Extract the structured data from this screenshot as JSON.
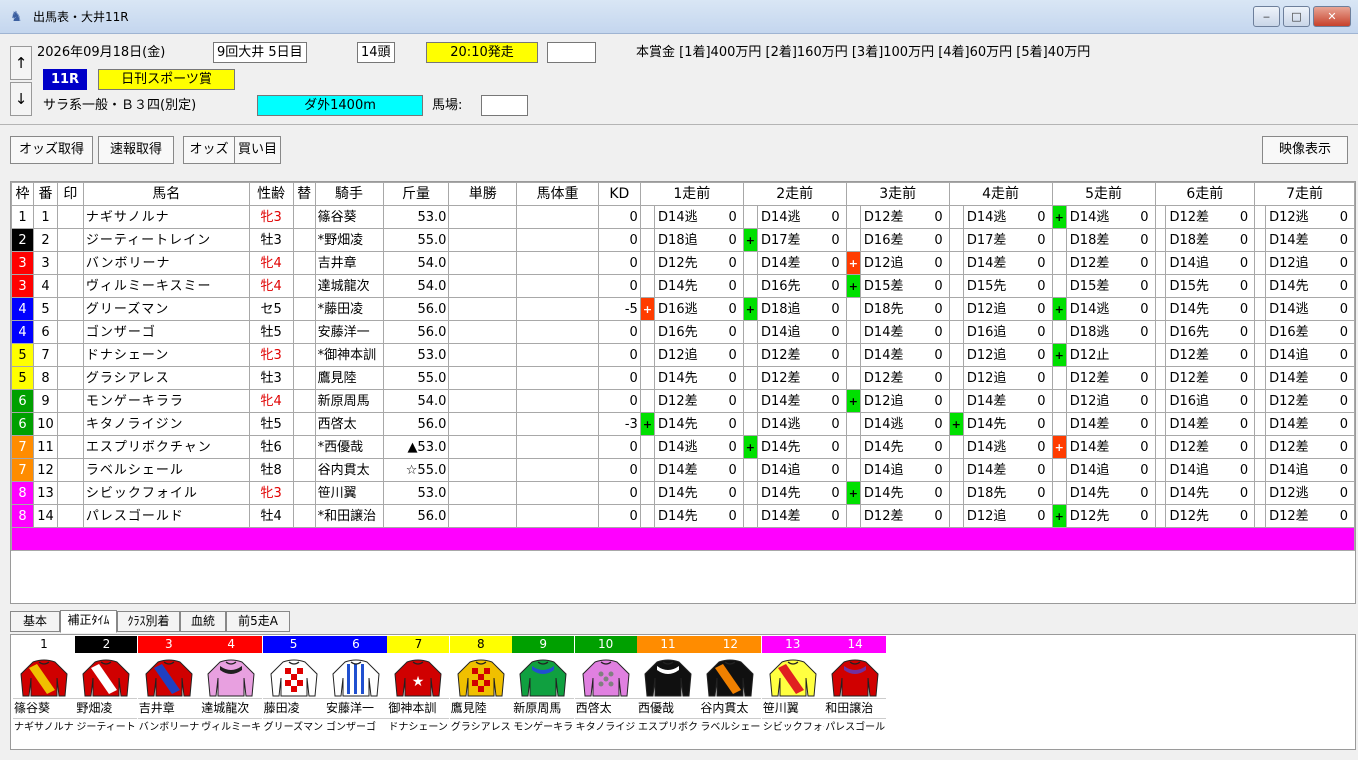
{
  "window": {
    "title": "出馬表・大井11R",
    "minimize": "‒",
    "maximize": "□",
    "close": "✕"
  },
  "header": {
    "up": "↑",
    "down": "↓",
    "date": "2026年09月18日(金)",
    "meeting": "9回大井 5日目",
    "runners": "14頭",
    "post_time": "20:10発走",
    "extra_box": "",
    "prize": "本賞金 [1着]400万円 [2着]160万円 [3着]100万円 [4着]60万円 [5着]40万円",
    "race_number": "11R",
    "race_name": "日刊スポーツ賞",
    "conditions": "サラ系一般・Ｂ３四(別定)",
    "course": "ダ外1400m",
    "going_label": "馬場:",
    "going_value": ""
  },
  "toolbar": {
    "odds_fetch": "オッズ取得",
    "flash_fetch": "速報取得",
    "odds": "オッズ",
    "bets": "買い目",
    "video": "映像表示"
  },
  "colors": {
    "frame": [
      "#ffffff",
      "#000000",
      "#ff0000",
      "#0000ff",
      "#ffff00",
      "#00a000",
      "#ff8c00",
      "#ff00ff"
    ]
  },
  "columns": {
    "frame": "枠",
    "number": "番",
    "mark": "印",
    "horse": "馬名",
    "sexage": "性齢",
    "change": "替",
    "jockey": "騎手",
    "weight": "斤量",
    "win": "単勝",
    "bodyweight": "馬体重",
    "kd": "KD",
    "prev": [
      "1走前",
      "2走前",
      "3走前",
      "4走前",
      "5走前",
      "6走前",
      "7走前"
    ]
  },
  "rows": [
    {
      "frame": "1",
      "fi": 0,
      "num": "1",
      "horse": "ナギサノルナ",
      "sexage": "牝3",
      "female": true,
      "jockey": "篠谷葵",
      "weight": "53.0",
      "kd": "0",
      "prev": [
        [
          "",
          "D14逃",
          "0"
        ],
        [
          "",
          "D14逃",
          "0"
        ],
        [
          "",
          "D12差",
          "0"
        ],
        [
          "",
          "D14逃",
          "0"
        ],
        [
          "g",
          "D14逃",
          "0"
        ],
        [
          "",
          "D12差",
          "0"
        ],
        [
          "",
          "D12逃",
          "0"
        ]
      ]
    },
    {
      "frame": "2",
      "fi": 1,
      "num": "2",
      "horse": "ジーティートレイン",
      "sexage": "牡3",
      "female": false,
      "jockey": "*野畑凌",
      "weight": "55.0",
      "kd": "0",
      "prev": [
        [
          "",
          "D18追",
          "0"
        ],
        [
          "g",
          "D17差",
          "0"
        ],
        [
          "",
          "D16差",
          "0"
        ],
        [
          "",
          "D17差",
          "0"
        ],
        [
          "",
          "D18差",
          "0"
        ],
        [
          "",
          "D18差",
          "0"
        ],
        [
          "",
          "D14差",
          "0"
        ]
      ]
    },
    {
      "frame": "3",
      "fi": 2,
      "num": "3",
      "horse": "バンボリーナ",
      "sexage": "牝4",
      "female": true,
      "jockey": "吉井章",
      "weight": "54.0",
      "kd": "0",
      "prev": [
        [
          "",
          "D12先",
          "0"
        ],
        [
          "",
          "D14差",
          "0"
        ],
        [
          "r",
          "D12追",
          "0"
        ],
        [
          "",
          "D14差",
          "0"
        ],
        [
          "",
          "D12差",
          "0"
        ],
        [
          "",
          "D14追",
          "0"
        ],
        [
          "",
          "D12追",
          "0"
        ]
      ]
    },
    {
      "frame": "3",
      "fi": 2,
      "num": "4",
      "horse": "ヴィルミーキスミー",
      "sexage": "牝4",
      "female": true,
      "jockey": "達城龍次",
      "weight": "54.0",
      "kd": "0",
      "prev": [
        [
          "",
          "D14先",
          "0"
        ],
        [
          "",
          "D16先",
          "0"
        ],
        [
          "g",
          "D15差",
          "0"
        ],
        [
          "",
          "D15先",
          "0"
        ],
        [
          "",
          "D15差",
          "0"
        ],
        [
          "",
          "D15先",
          "0"
        ],
        [
          "",
          "D14先",
          "0"
        ]
      ]
    },
    {
      "frame": "4",
      "fi": 3,
      "num": "5",
      "horse": "グリーズマン",
      "sexage": "セ5",
      "female": false,
      "jockey": "*藤田凌",
      "weight": "56.0",
      "kd": "-5",
      "prev": [
        [
          "r",
          "D16逃",
          "0"
        ],
        [
          "g",
          "D18追",
          "0"
        ],
        [
          "",
          "D18先",
          "0"
        ],
        [
          "",
          "D12追",
          "0"
        ],
        [
          "g",
          "D14逃",
          "0"
        ],
        [
          "",
          "D14先",
          "0"
        ],
        [
          "",
          "D14逃",
          "0"
        ]
      ]
    },
    {
      "frame": "4",
      "fi": 3,
      "num": "6",
      "horse": "ゴンザーゴ",
      "sexage": "牡5",
      "female": false,
      "jockey": "安藤洋一",
      "weight": "56.0",
      "kd": "0",
      "prev": [
        [
          "",
          "D16先",
          "0"
        ],
        [
          "",
          "D14追",
          "0"
        ],
        [
          "",
          "D14差",
          "0"
        ],
        [
          "",
          "D16追",
          "0"
        ],
        [
          "",
          "D18逃",
          "0"
        ],
        [
          "",
          "D16先",
          "0"
        ],
        [
          "",
          "D16差",
          "0"
        ]
      ]
    },
    {
      "frame": "5",
      "fi": 4,
      "num": "7",
      "horse": "ドナシェーン",
      "sexage": "牝3",
      "female": true,
      "jockey": "*御神本訓",
      "weight": "53.0",
      "kd": "0",
      "prev": [
        [
          "",
          "D12追",
          "0"
        ],
        [
          "",
          "D12差",
          "0"
        ],
        [
          "",
          "D14差",
          "0"
        ],
        [
          "",
          "D12追",
          "0"
        ],
        [
          "g",
          "D12止",
          ""
        ],
        [
          "",
          "D12差",
          "0"
        ],
        [
          "",
          "D14追",
          "0"
        ]
      ]
    },
    {
      "frame": "5",
      "fi": 4,
      "num": "8",
      "horse": "グラシアレス",
      "sexage": "牡3",
      "female": false,
      "jockey": "鷹見陸",
      "weight": "55.0",
      "kd": "0",
      "prev": [
        [
          "",
          "D14先",
          "0"
        ],
        [
          "",
          "D12差",
          "0"
        ],
        [
          "",
          "D12差",
          "0"
        ],
        [
          "",
          "D12追",
          "0"
        ],
        [
          "",
          "D12差",
          "0"
        ],
        [
          "",
          "D12差",
          "0"
        ],
        [
          "",
          "D14差",
          "0"
        ]
      ]
    },
    {
      "frame": "6",
      "fi": 5,
      "num": "9",
      "horse": "モンゲーキララ",
      "sexage": "牝4",
      "female": true,
      "jockey": "新原周馬",
      "weight": "54.0",
      "kd": "0",
      "prev": [
        [
          "",
          "D12差",
          "0"
        ],
        [
          "",
          "D14差",
          "0"
        ],
        [
          "g",
          "D12追",
          "0"
        ],
        [
          "",
          "D14差",
          "0"
        ],
        [
          "",
          "D12追",
          "0"
        ],
        [
          "",
          "D16追",
          "0"
        ],
        [
          "",
          "D12差",
          "0"
        ]
      ]
    },
    {
      "frame": "6",
      "fi": 5,
      "num": "10",
      "horse": "キタノライジン",
      "sexage": "牡5",
      "female": false,
      "jockey": "西啓太",
      "weight": "56.0",
      "kd": "-3",
      "prev": [
        [
          "g",
          "D14先",
          "0"
        ],
        [
          "",
          "D14逃",
          "0"
        ],
        [
          "",
          "D14逃",
          "0"
        ],
        [
          "g",
          "D14先",
          "0"
        ],
        [
          "",
          "D14差",
          "0"
        ],
        [
          "",
          "D14差",
          "0"
        ],
        [
          "",
          "D14差",
          "0"
        ]
      ]
    },
    {
      "frame": "7",
      "fi": 6,
      "num": "11",
      "horse": "エスプリボクチャン",
      "sexage": "牡6",
      "female": false,
      "jockey": "*西優哉",
      "weight": "▲53.0",
      "kd": "0",
      "prev": [
        [
          "",
          "D14逃",
          "0"
        ],
        [
          "g",
          "D14先",
          "0"
        ],
        [
          "",
          "D14先",
          "0"
        ],
        [
          "",
          "D14逃",
          "0"
        ],
        [
          "r",
          "D14差",
          "0"
        ],
        [
          "",
          "D12差",
          "0"
        ],
        [
          "",
          "D12差",
          "0"
        ]
      ]
    },
    {
      "frame": "7",
      "fi": 6,
      "num": "12",
      "horse": "ラベルシェール",
      "sexage": "牡8",
      "female": false,
      "jockey": "谷内貫太",
      "weight": "☆55.0",
      "kd": "0",
      "prev": [
        [
          "",
          "D14差",
          "0"
        ],
        [
          "",
          "D14追",
          "0"
        ],
        [
          "",
          "D14追",
          "0"
        ],
        [
          "",
          "D14差",
          "0"
        ],
        [
          "",
          "D14追",
          "0"
        ],
        [
          "",
          "D14追",
          "0"
        ],
        [
          "",
          "D14追",
          "0"
        ]
      ]
    },
    {
      "frame": "8",
      "fi": 7,
      "num": "13",
      "horse": "シビックフォイル",
      "sexage": "牝3",
      "female": true,
      "jockey": "笹川翼",
      "weight": "53.0",
      "kd": "0",
      "prev": [
        [
          "",
          "D14先",
          "0"
        ],
        [
          "",
          "D14先",
          "0"
        ],
        [
          "g",
          "D14先",
          "0"
        ],
        [
          "",
          "D18先",
          "0"
        ],
        [
          "",
          "D14先",
          "0"
        ],
        [
          "",
          "D14先",
          "0"
        ],
        [
          "",
          "D12逃",
          "0"
        ]
      ]
    },
    {
      "frame": "8",
      "fi": 7,
      "num": "14",
      "horse": "パレスゴールド",
      "sexage": "牡4",
      "female": false,
      "jockey": "*和田譲治",
      "weight": "56.0",
      "kd": "0",
      "prev": [
        [
          "",
          "D14先",
          "0"
        ],
        [
          "",
          "D14差",
          "0"
        ],
        [
          "",
          "D12差",
          "0"
        ],
        [
          "",
          "D12追",
          "0"
        ],
        [
          "g",
          "D12先",
          "0"
        ],
        [
          "",
          "D12先",
          "0"
        ],
        [
          "",
          "D12差",
          "0"
        ]
      ]
    }
  ],
  "tabs": [
    "基本",
    "補正ﾀｲﾑ",
    "ｸﾗｽ別着",
    "血統",
    "前5走A"
  ],
  "active_tab": 1,
  "bottom": [
    {
      "num": "1",
      "fi": 0,
      "jockey": "篠谷葵",
      "horse": "ナギサノルナ",
      "silk": "#d00000",
      "accent": "#f0c000",
      "pattern": "sash"
    },
    {
      "num": "2",
      "fi": 1,
      "jockey": "野畑凌",
      "horse": "ジーティートレイン",
      "silk": "#d00000",
      "accent": "#ffffff",
      "pattern": "sash"
    },
    {
      "num": "3",
      "fi": 2,
      "jockey": "吉井章",
      "horse": "バンボリーナ",
      "silk": "#d00000",
      "accent": "#2040c0",
      "pattern": "sash"
    },
    {
      "num": "4",
      "fi": 3,
      "jockey": "達城龍次",
      "horse": "ヴィルミーキスミー",
      "silk": "#e8a0e0",
      "accent": "#202020",
      "pattern": "plain"
    },
    {
      "num": "5",
      "fi": 4,
      "jockey": "藤田凌",
      "horse": "グリーズマン",
      "silk": "#ffffff",
      "accent": "#e00000",
      "pattern": "check"
    },
    {
      "num": "6",
      "fi": 5,
      "jockey": "安藤洋一",
      "horse": "ゴンザーゴ",
      "silk": "#ffffff",
      "accent": "#2050d0",
      "pattern": "stripe"
    },
    {
      "num": "7",
      "fi": 6,
      "jockey": "御神本訓",
      "horse": "ドナシェーン",
      "silk": "#d00000",
      "accent": "#ffffff",
      "pattern": "star"
    },
    {
      "num": "8",
      "fi": 7,
      "jockey": "鷹見陸",
      "horse": "グラシアレス",
      "silk": "#f0c000",
      "accent": "#d00000",
      "pattern": "check"
    },
    {
      "num": "9",
      "fi": 8,
      "jockey": "新原周馬",
      "horse": "モンゲーキララ",
      "silk": "#10a040",
      "accent": "#2050d0",
      "pattern": "plain"
    },
    {
      "num": "10",
      "fi": 9,
      "jockey": "西啓太",
      "horse": "キタノライジン",
      "silk": "#e080e0",
      "accent": "#808080",
      "pattern": "dots"
    },
    {
      "num": "11",
      "fi": 10,
      "jockey": "西優哉",
      "horse": "エスプリボクチャン",
      "silk": "#101010",
      "accent": "#ffffff",
      "pattern": "plain"
    },
    {
      "num": "12",
      "fi": 11,
      "jockey": "谷内貫太",
      "horse": "ラベルシェール",
      "silk": "#101010",
      "accent": "#f08000",
      "pattern": "sash"
    },
    {
      "num": "13",
      "fi": 12,
      "jockey": "笹川翼",
      "horse": "シビックフォイル",
      "silk": "#ffff40",
      "accent": "#e02020",
      "pattern": "sash"
    },
    {
      "num": "14",
      "fi": 13,
      "jockey": "和田譲治",
      "horse": "パレスゴールド",
      "silk": "#d00000",
      "accent": "#7030a0",
      "pattern": "plain"
    }
  ],
  "bottom_header_colors": [
    "#ffffff",
    "#000000",
    "#ff0000",
    "#ff0000",
    "#0000ff",
    "#0000ff",
    "#ffff00",
    "#ffff00",
    "#00a000",
    "#00a000",
    "#ff8c00",
    "#ff8c00",
    "#ff00ff",
    "#ff00ff"
  ]
}
